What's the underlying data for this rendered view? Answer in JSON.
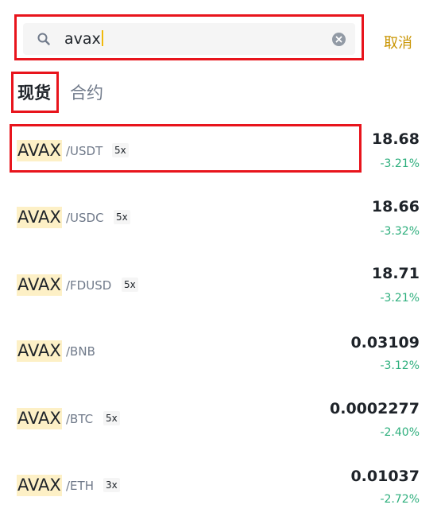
{
  "search": {
    "value": "avax",
    "cancel_label": "取消"
  },
  "tabs": [
    {
      "label": "现货",
      "active": true
    },
    {
      "label": "合约",
      "active": false
    }
  ],
  "pairs": [
    {
      "base": "AVAX",
      "quote": "/USDT",
      "leverage": "5x",
      "price": "18.68",
      "change": "-3.21%"
    },
    {
      "base": "AVAX",
      "quote": "/USDC",
      "leverage": "5x",
      "price": "18.66",
      "change": "-3.32%"
    },
    {
      "base": "AVAX",
      "quote": "/FDUSD",
      "leverage": "5x",
      "price": "18.71",
      "change": "-3.21%"
    },
    {
      "base": "AVAX",
      "quote": "/BNB",
      "leverage": "",
      "price": "0.03109",
      "change": "-3.12%"
    },
    {
      "base": "AVAX",
      "quote": "/BTC",
      "leverage": "5x",
      "price": "0.0002277",
      "change": "-2.40%"
    },
    {
      "base": "AVAX",
      "quote": "/ETH",
      "leverage": "3x",
      "price": "0.01037",
      "change": "-2.72%"
    }
  ],
  "colors": {
    "accent": "#f0b90b",
    "cancel": "#c99400",
    "positive_change": "#2eaf7d",
    "highlight": "#e8141c"
  }
}
